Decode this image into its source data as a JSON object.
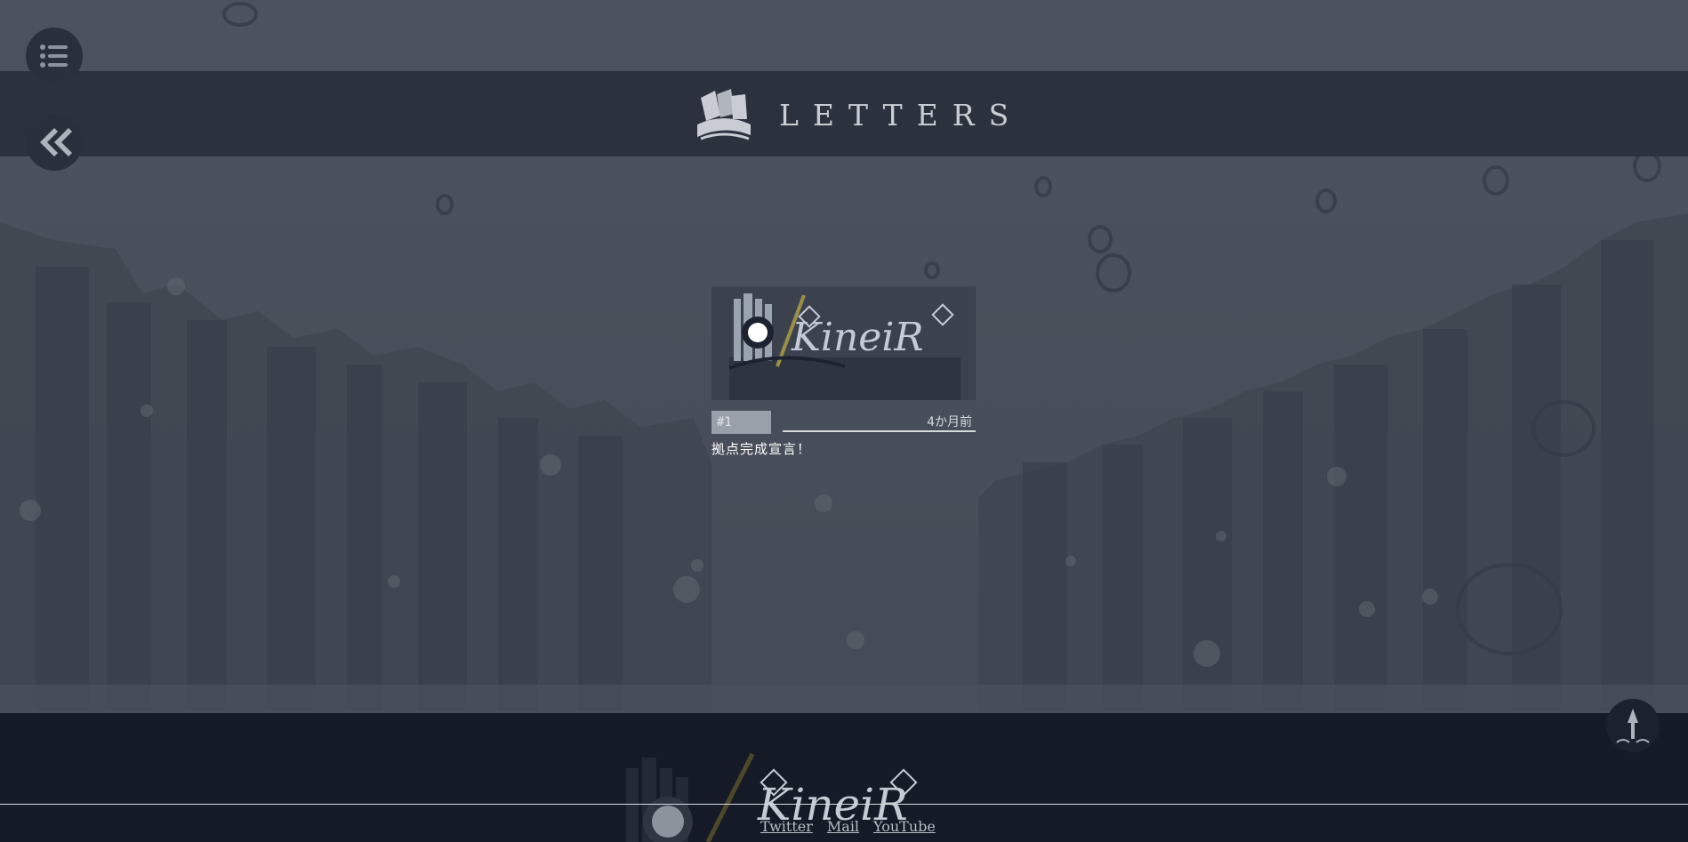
{
  "header": {
    "title": "LETTERS",
    "logo_icon": "letters-bundle-icon"
  },
  "nav": {
    "menu_icon": "list-icon",
    "back_icon": "double-chevron-left-icon"
  },
  "post": {
    "number": "#1",
    "time": "4か月前",
    "title": "拠点完成宣言！",
    "thumbnail_logo": "KineiR"
  },
  "footer": {
    "logo": "KineiR",
    "links": [
      {
        "label": "Twitter"
      },
      {
        "label": "Mail"
      },
      {
        "label": "YouTube"
      }
    ],
    "top_icon": "arrow-up-icon"
  },
  "colors": {
    "background": "#4a525d",
    "header_band": "#2c323d",
    "footer": "#141b26",
    "text_light": "#c9ccd2"
  }
}
